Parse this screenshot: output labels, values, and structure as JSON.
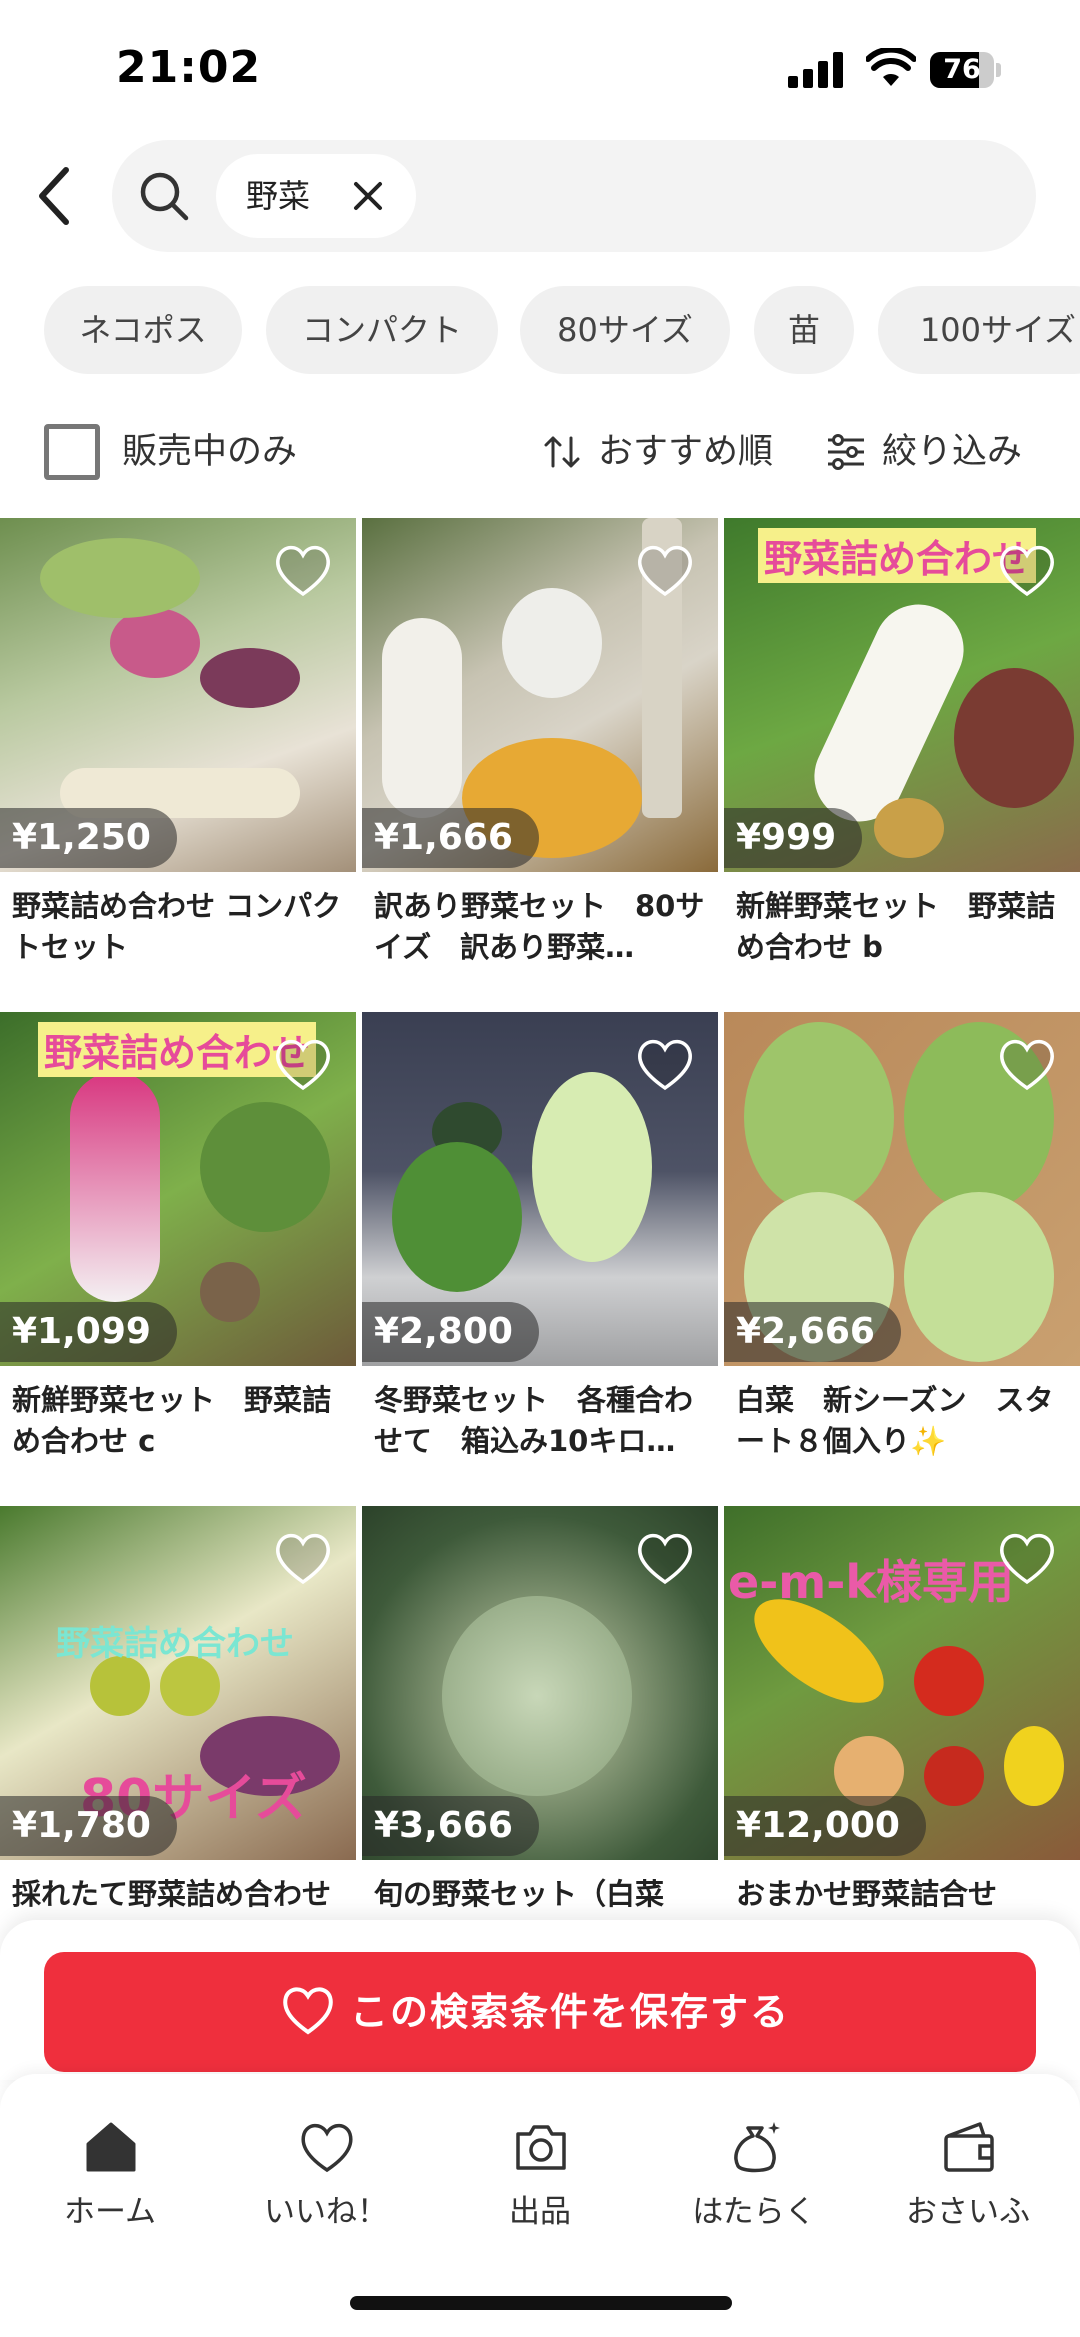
{
  "status_bar": {
    "time": "21:02",
    "battery": "76",
    "battery_level": 0.76
  },
  "search": {
    "query": "野菜"
  },
  "filter_chips": [
    "ネコポス",
    "コンパクト",
    "80サイズ",
    "苗",
    "100サイズ"
  ],
  "controls": {
    "on_sale_only": "販売中のみ",
    "on_sale_checked": false,
    "sort": "おすすめ順",
    "filter": "絞り込み"
  },
  "items": [
    {
      "price": "¥1,250",
      "title": "野菜詰め合わせ コンパクトセット",
      "overlay": ""
    },
    {
      "price": "¥1,666",
      "title": "訳あり野菜セット　80サイズ　訳あり野菜…",
      "overlay": ""
    },
    {
      "price": "¥999",
      "title": "新鮮野菜セット　野菜詰め合わせ b",
      "overlay": "野菜詰め合わせ"
    },
    {
      "price": "¥1,099",
      "title": "新鮮野菜セット　野菜詰め合わせ c",
      "overlay": "野菜詰め合わせ"
    },
    {
      "price": "¥2,800",
      "title": "冬野菜セット　各種合わせて　箱込み10キロ…",
      "overlay": ""
    },
    {
      "price": "¥2,666",
      "title": "白菜　新シーズン　スタート８個入り✨",
      "overlay": ""
    },
    {
      "price": "¥1,780",
      "title": "採れたて野菜詰め合わせ",
      "overlay": "野菜詰め合わせ",
      "overlay2": "80サイズ"
    },
    {
      "price": "¥3,666",
      "title": "旬の野菜セット（白菜",
      "overlay": ""
    },
    {
      "price": "¥12,000",
      "title": "おまかせ野菜詰合せ",
      "overlay": "e-m-k様専用"
    }
  ],
  "save_search": {
    "label": "この検索条件を保存する"
  },
  "bottom_nav": [
    {
      "label": "ホーム",
      "icon": "home-icon"
    },
    {
      "label": "いいね！",
      "icon": "heart-icon"
    },
    {
      "label": "出品",
      "icon": "camera-icon"
    },
    {
      "label": "はたらく",
      "icon": "bag-icon"
    },
    {
      "label": "おさいふ",
      "icon": "wallet-icon"
    }
  ],
  "colors": {
    "accent": "#ef2f3d",
    "chip_bg": "#f0f0f0",
    "search_bg": "#f3f3f3"
  }
}
